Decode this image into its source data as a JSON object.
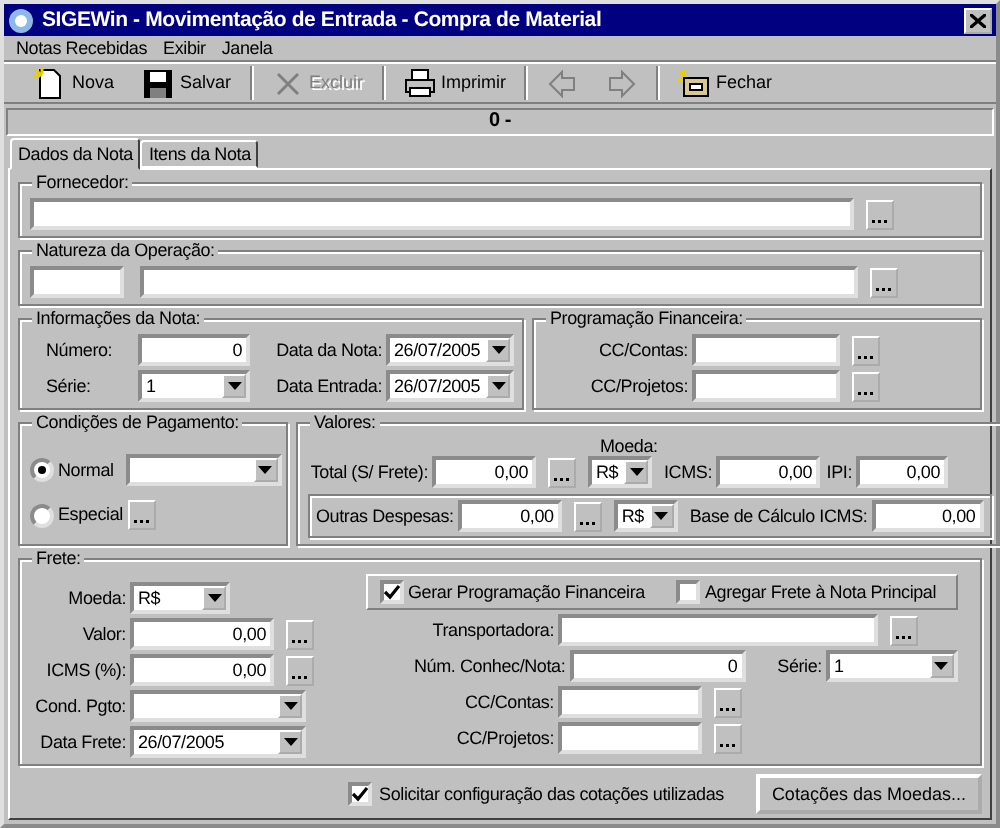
{
  "window": {
    "title": "SIGEWin - Movimentação de Entrada - Compra de Material"
  },
  "menu": [
    {
      "label": "Notas Recebidas"
    },
    {
      "label": "Exibir"
    },
    {
      "label": "Janela"
    }
  ],
  "toolbar": [
    {
      "kind": "new",
      "label": "Nova",
      "disabled": false
    },
    {
      "kind": "save",
      "label": "Salvar",
      "disabled": false
    },
    {
      "kind": "separator"
    },
    {
      "kind": "delete",
      "label": "Excluir",
      "disabled": true
    },
    {
      "kind": "separator"
    },
    {
      "kind": "print",
      "label": "Imprimir",
      "disabled": false
    },
    {
      "kind": "separator"
    },
    {
      "kind": "back",
      "disabled": true
    },
    {
      "kind": "forward",
      "disabled": true
    },
    {
      "kind": "separator"
    },
    {
      "kind": "close",
      "label": "Fechar",
      "disabled": false
    }
  ],
  "record_header": {
    "text": "0 -"
  },
  "tabs": [
    {
      "label": "Dados da Nota",
      "selected": true
    },
    {
      "label": "Itens da Nota",
      "selected": false
    }
  ],
  "fornecedor": {
    "title": "Fornecedor:",
    "fields": [
      {
        "kind": "text",
        "lookup": true
      }
    ]
  },
  "natureza": {
    "title": "Natureza da Operação:",
    "fields": [
      {
        "kind": "text"
      },
      {
        "kind": "text",
        "lookup": true
      }
    ]
  },
  "informacoes": {
    "title": "Informações da Nota:",
    "fields": [
      {
        "label": "Número:",
        "kind": "number",
        "value": "0"
      },
      {
        "label": "Data da Nota:",
        "kind": "combo",
        "value": "26/07/2005"
      },
      {
        "label": "Série:",
        "kind": "combo",
        "value": "1"
      },
      {
        "label": "Data Entrada:",
        "kind": "combo",
        "value": "26/07/2005"
      }
    ]
  },
  "programacao": {
    "title": "Programação Financeira:",
    "fields": [
      {
        "label": "CC/Contas:",
        "kind": "text",
        "lookup": true
      },
      {
        "label": "CC/Projetos:",
        "kind": "text",
        "lookup": true
      }
    ]
  },
  "pagamento": {
    "title": "Condições de Pagamento:",
    "options": [
      {
        "label": "Normal",
        "selected": true,
        "kind": "combo"
      },
      {
        "label": "Especial",
        "selected": false,
        "kind": "lookup"
      }
    ]
  },
  "valores": {
    "title": "Valores:",
    "currency_caption": "Moeda:",
    "fields": [
      {
        "label": "Total (S/ Frete):",
        "kind": "number",
        "value": "0,00",
        "lookup": true
      },
      {
        "kind": "combo",
        "value": "R$"
      },
      {
        "label": "ICMS:",
        "kind": "number",
        "value": "0,00"
      },
      {
        "label": "IPI:",
        "kind": "number",
        "value": "0,00"
      }
    ],
    "other": [
      {
        "label": "Outras Despesas:",
        "kind": "number",
        "value": "0,00",
        "lookup": true
      },
      {
        "kind": "combo",
        "value": "R$"
      },
      {
        "label": "Base de Cálculo ICMS:",
        "kind": "number",
        "value": "0,00"
      }
    ]
  },
  "frete": {
    "title": "Frete:",
    "options": [
      {
        "label": "Gerar Programação Financeira",
        "checked": true
      },
      {
        "label": "Agregar Frete à Nota Principal",
        "checked": false
      }
    ],
    "left": [
      {
        "label": "Moeda:",
        "kind": "combo",
        "value": "R$"
      },
      {
        "label": "Valor:",
        "kind": "number",
        "value": "0,00",
        "lookup": true
      },
      {
        "label": "ICMS (%):",
        "kind": "number",
        "value": "0,00",
        "lookup": true
      },
      {
        "label": "Cond. Pgto:",
        "kind": "combo"
      },
      {
        "label": "Data Frete:",
        "kind": "combo",
        "value": "26/07/2005"
      }
    ],
    "right": [
      {
        "label": "Transportadora:",
        "kind": "text",
        "lookup": true
      },
      {
        "label": "Núm. Conhec/Nota:",
        "kind": "number",
        "value": "0"
      },
      {
        "label": "Série:",
        "kind": "combo",
        "value": "1"
      },
      {
        "label": "CC/Contas:",
        "kind": "text",
        "lookup": true
      },
      {
        "label": "CC/Projetos:",
        "kind": "text",
        "lookup": true
      }
    ]
  },
  "footer": {
    "checkbox": {
      "label": "Solicitar configuração das cotações utilizadas",
      "checked": true
    },
    "button": {
      "label": "Cotações das Moedas..."
    }
  }
}
